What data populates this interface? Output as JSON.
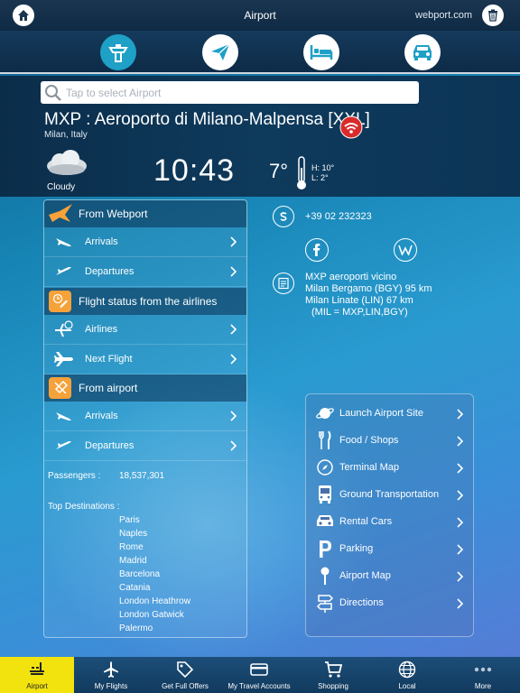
{
  "topbar": {
    "title": "Airport",
    "brand": "webport.com"
  },
  "search": {
    "placeholder": "Tap to select Airport"
  },
  "airport": {
    "name": "MXP : Aeroporto di Milano-Malpensa [XXL]",
    "city": "Milan, Italy"
  },
  "weather": {
    "condition": "Cloudy",
    "time": "10:43",
    "temp": "7°",
    "high": "H: 10°",
    "low": "L: 2°"
  },
  "sections": {
    "webport": {
      "title": "From Webport",
      "arrivals": "Arrivals",
      "departures": "Departures"
    },
    "airlines": {
      "title": "Flight status from the airlines",
      "airlines": "Airlines",
      "next_flight": "Next Flight"
    },
    "airport": {
      "title": "From airport",
      "arrivals": "Arrivals",
      "departures": "Departures"
    }
  },
  "stats": {
    "passengers_label": "Passengers :",
    "passengers_value": "18,537,301",
    "destinations_label": "Top  Destinations :"
  },
  "destinations": [
    "Paris",
    "Naples",
    "Rome",
    "Madrid",
    "Barcelona",
    "Catania",
    "London Heathrow",
    "London Gatwick",
    "Palermo"
  ],
  "contact": {
    "phone": "+39 02 232323",
    "nearby": [
      "MXP aeroporti vicino",
      "Milan Bergamo (BGY) 95 km",
      "Milan Linate (LIN) 67 km",
      "  (MIL = MXP,LIN,BGY)"
    ]
  },
  "services": [
    "Launch Airport Site",
    "Food / Shops",
    "Terminal Map",
    "Ground Transportation",
    "Rental Cars",
    "Parking",
    "Airport Map",
    "Directions"
  ],
  "tabs": [
    "Airport",
    "My Flights",
    "Get Full Offers",
    "My Travel Accounts",
    "Shopping",
    "Local",
    "More"
  ],
  "colors": {
    "accent_orange": "#f6a23a",
    "active_tab": "#f2e30f",
    "active_category": "#1fa0c7"
  }
}
